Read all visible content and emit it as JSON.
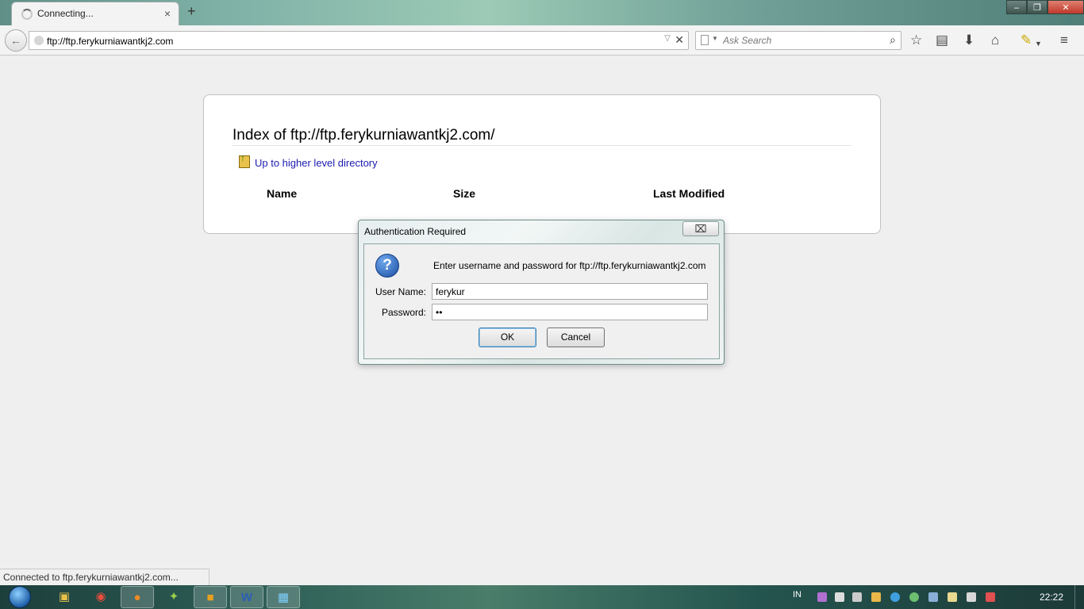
{
  "browser": {
    "tab": {
      "title": "Connecting...",
      "close_glyph": "×"
    },
    "new_tab_glyph": "+",
    "window_buttons": {
      "minimize": "‒",
      "restore": "❐",
      "close": "✕"
    },
    "url": "ftp://ftp.ferykurniawantkj2.com",
    "search": {
      "placeholder": "Ask Search"
    },
    "toolbar_icons": [
      "bookmark-star-icon",
      "reading-list-icon",
      "downloads-icon",
      "home-icon",
      "highlighter-icon",
      "menu-icon"
    ]
  },
  "page": {
    "heading": "Index of ftp://ftp.ferykurniawantkj2.com/",
    "up_link": "Up to higher level directory",
    "columns": {
      "name": "Name",
      "size": "Size",
      "last_modified": "Last Modified"
    }
  },
  "dialog": {
    "title": "Authentication Required",
    "close_glyph": "⌧",
    "icon_glyph": "?",
    "message": "Enter username and password for ftp://ftp.ferykurniawantkj2.com",
    "username_label": "User Name:",
    "username_value": "ferykur",
    "password_label": "Password:",
    "password_value": "••",
    "ok_label": "OK",
    "cancel_label": "Cancel"
  },
  "status": {
    "text": "Connected to ftp.ferykurniawantkj2.com..."
  },
  "taskbar": {
    "language": "IN",
    "clock": "22:22",
    "tasks": [
      "file-explorer-icon",
      "chrome-icon",
      "firefox-icon",
      "network-icon",
      "folder-icon",
      "word-icon",
      "app-icon"
    ]
  },
  "colors": {
    "accent": "#1a1ab0",
    "titlebar": "#7fb0a6",
    "taskbar": "#2f6058"
  }
}
